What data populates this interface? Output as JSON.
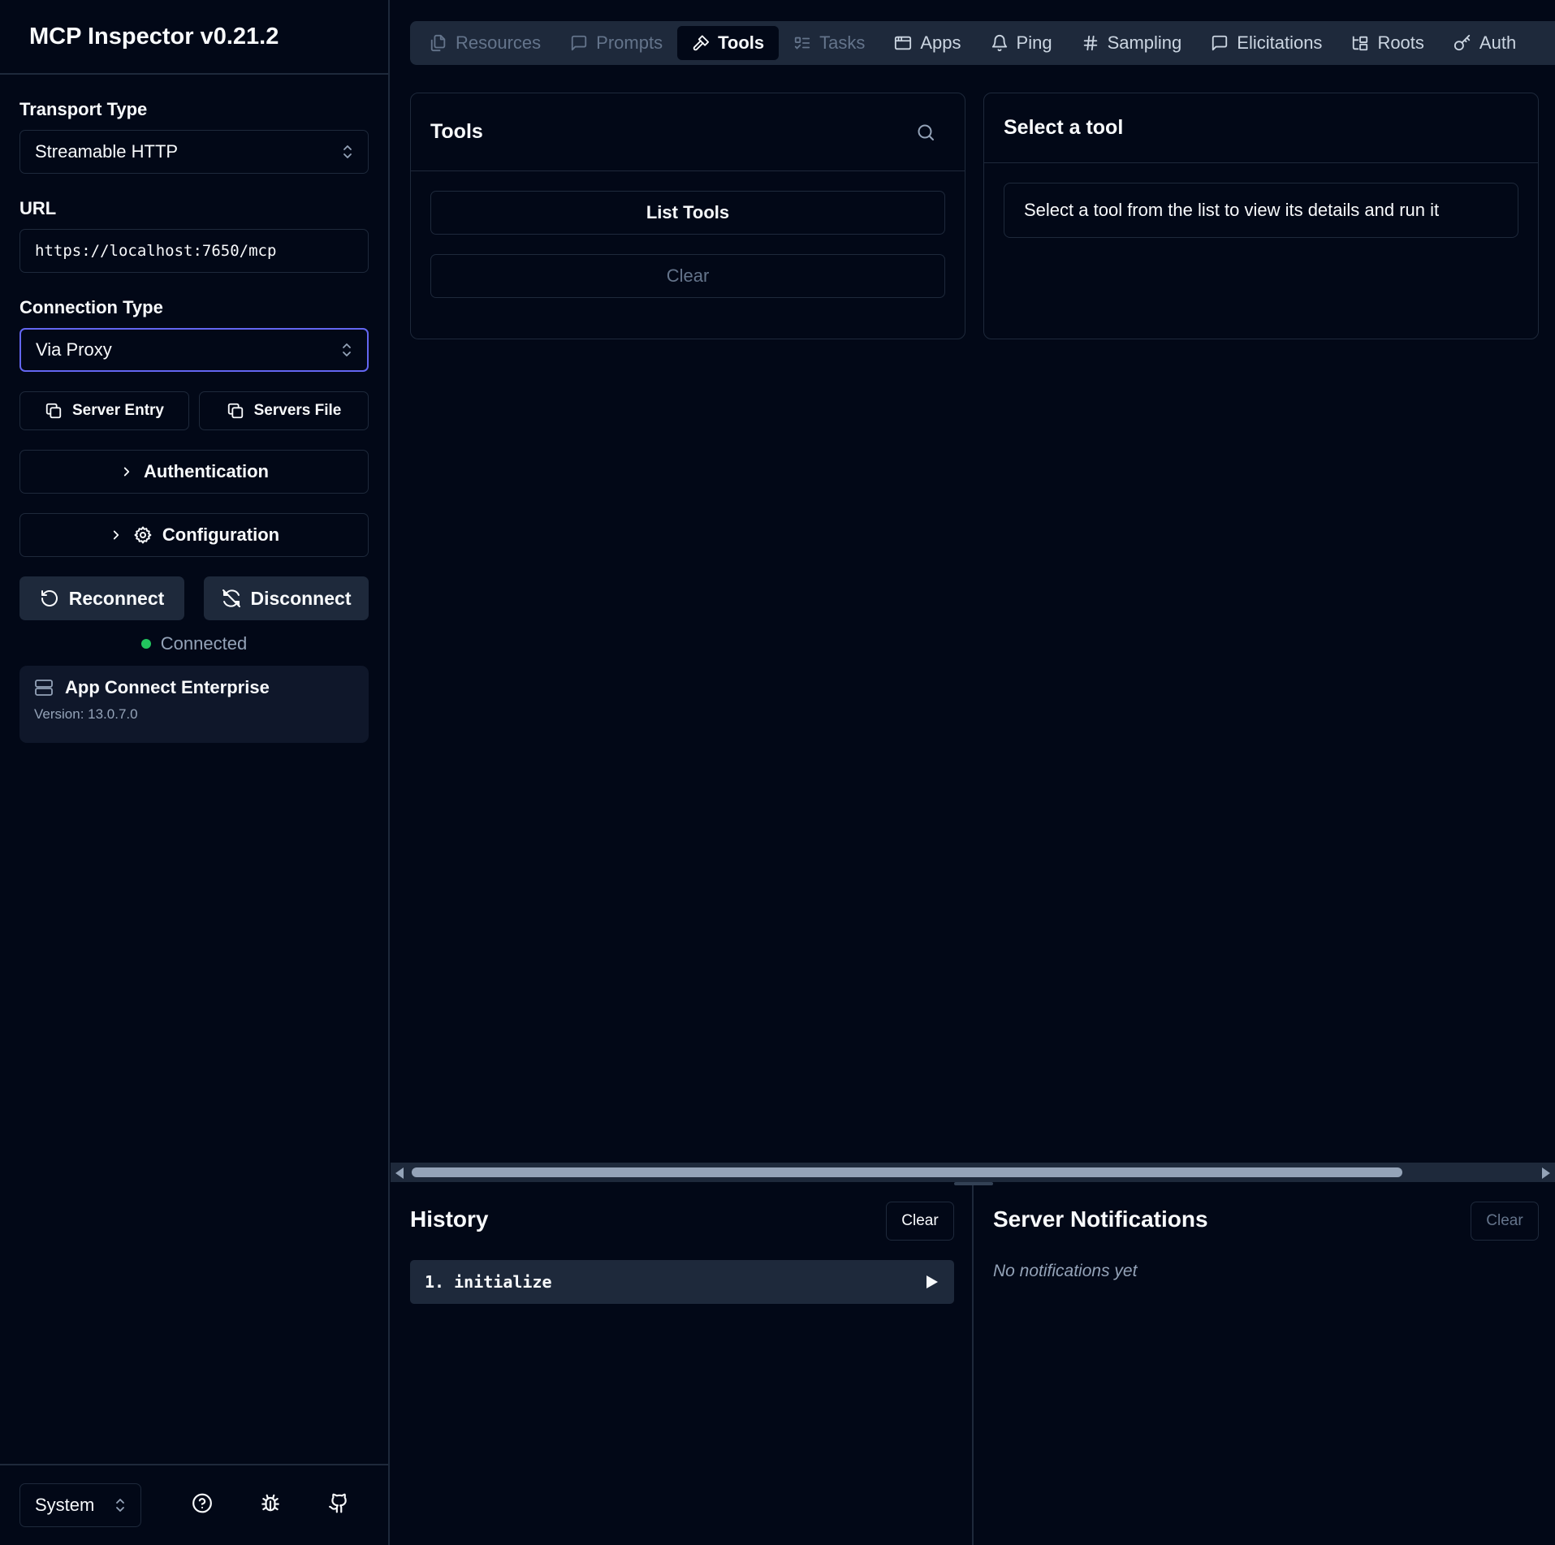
{
  "app": {
    "title": "MCP Inspector v0.21.2"
  },
  "sidebar": {
    "transport_label": "Transport Type",
    "transport_value": "Streamable HTTP",
    "url_label": "URL",
    "url_value": "https://localhost:7650/mcp",
    "connection_label": "Connection Type",
    "connection_value": "Via Proxy",
    "server_entry_label": "Server Entry",
    "servers_file_label": "Servers File",
    "authentication_label": "Authentication",
    "configuration_label": "Configuration",
    "reconnect_label": "Reconnect",
    "disconnect_label": "Disconnect",
    "status_text": "Connected",
    "server": {
      "name": "App Connect Enterprise",
      "version": "Version: 13.0.7.0"
    },
    "theme_value": "System"
  },
  "tabs": [
    {
      "label": "Resources",
      "icon": "files-icon",
      "state": "disabled"
    },
    {
      "label": "Prompts",
      "icon": "message-icon",
      "state": "disabled"
    },
    {
      "label": "Tools",
      "icon": "hammer-icon",
      "state": "active"
    },
    {
      "label": "Tasks",
      "icon": "list-todo-icon",
      "state": "disabled"
    },
    {
      "label": "Apps",
      "icon": "app-window-icon",
      "state": "normal"
    },
    {
      "label": "Ping",
      "icon": "bell-icon",
      "state": "normal"
    },
    {
      "label": "Sampling",
      "icon": "hash-icon",
      "state": "normal"
    },
    {
      "label": "Elicitations",
      "icon": "message-icon",
      "state": "normal"
    },
    {
      "label": "Roots",
      "icon": "folder-tree-icon",
      "state": "normal"
    },
    {
      "label": "Auth",
      "icon": "key-icon",
      "state": "normal"
    }
  ],
  "tools_panel": {
    "title": "Tools",
    "list_button": "List Tools",
    "clear_button": "Clear"
  },
  "detail_panel": {
    "title": "Select a tool",
    "hint": "Select a tool from the list to view its details and run it"
  },
  "history": {
    "title": "History",
    "clear_button": "Clear",
    "items": [
      {
        "label": "1. initialize"
      }
    ]
  },
  "notifications": {
    "title": "Server Notifications",
    "clear_button": "Clear",
    "empty_text": "No notifications yet"
  },
  "colors": {
    "background": "#020817",
    "border": "#1e293b",
    "accent_focus": "#6366f1",
    "status_connected": "#22c55e",
    "muted_text": "#94a3b8"
  }
}
